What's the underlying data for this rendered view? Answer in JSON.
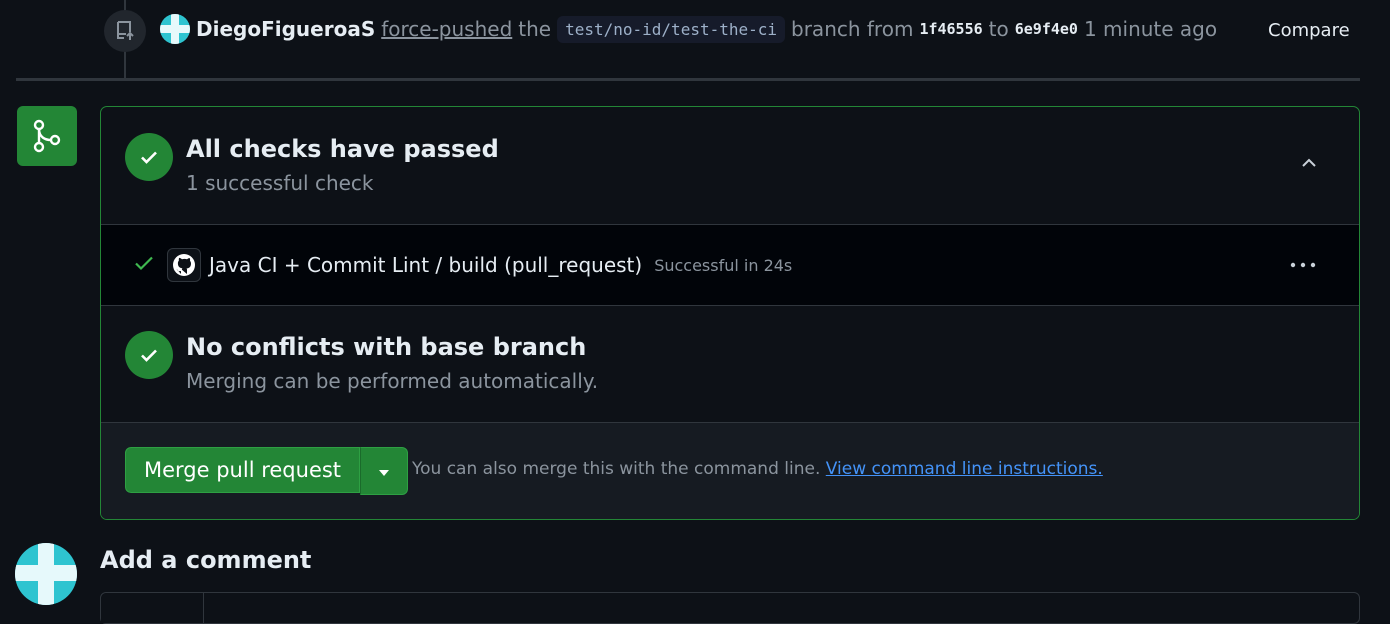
{
  "timeline_event": {
    "user": "DiegoFigueroaS",
    "action": "force-pushed",
    "the_word": "the",
    "branch": "test/no-id/test-the-ci",
    "branch_suffix": "branch from",
    "from_sha": "1f46556",
    "to_word": "to",
    "to_sha": "6e9f4e0",
    "time": "1 minute ago",
    "compare_label": "Compare",
    "icon": "repo-push-icon"
  },
  "merge_box": {
    "checks": {
      "title": "All checks have passed",
      "subtitle": "1 successful check",
      "icon": "check-circle-icon"
    },
    "job": {
      "name": "Java CI + Commit Lint / build (pull_request)",
      "status": "Successful in 24s"
    },
    "conflicts": {
      "title": "No conflicts with base branch",
      "subtitle": "Merging can be performed automatically."
    },
    "merge": {
      "button_label": "Merge pull request",
      "hint_text": "You can also merge this with the command line.",
      "hint_link": "View command line instructions."
    }
  },
  "comment": {
    "title": "Add a comment"
  },
  "colors": {
    "success": "#238636",
    "link": "#4493f8",
    "background": "#0d1117"
  }
}
